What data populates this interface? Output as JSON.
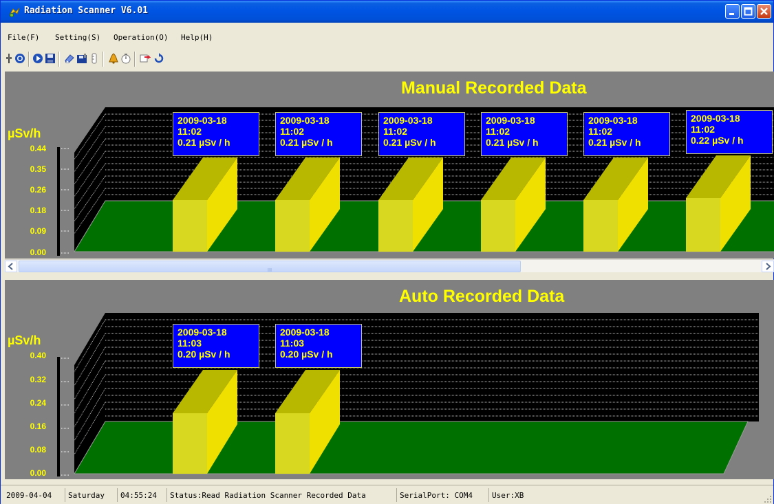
{
  "window": {
    "title": "Radiation Scanner V6.01"
  },
  "menu": [
    {
      "label": "File(F)"
    },
    {
      "label": "Setting(S)"
    },
    {
      "label": "Operation(O)"
    },
    {
      "label": "Help(H)"
    }
  ],
  "toolbar": [
    {
      "icon": "connect-icon"
    },
    {
      "icon": "stop-icon"
    },
    {
      "icon": "play-icon"
    },
    {
      "icon": "save-icon"
    },
    {
      "icon": "erase-icon"
    },
    {
      "icon": "save-disk-icon"
    },
    {
      "icon": "ruler-icon"
    },
    {
      "icon": "alarm-bell-icon"
    },
    {
      "icon": "timer-icon"
    },
    {
      "icon": "export-icon"
    },
    {
      "icon": "refresh-icon"
    }
  ],
  "charts": [
    {
      "title": "Manual Recorded Data",
      "unit": "µSv/h",
      "yticks": [
        "0.44",
        "0.35",
        "0.26",
        "0.18",
        "0.09",
        "0.00"
      ],
      "bars": [
        {
          "date": "2009-03-18",
          "time": "11:02",
          "value": "0.21 µSv / h"
        },
        {
          "date": "2009-03-18",
          "time": "11:02",
          "value": "0.21 µSv / h"
        },
        {
          "date": "2009-03-18",
          "time": "11:02",
          "value": "0.21 µSv / h"
        },
        {
          "date": "2009-03-18",
          "time": "11:02",
          "value": "0.21 µSv / h"
        },
        {
          "date": "2009-03-18",
          "time": "11:02",
          "value": "0.21 µSv / h"
        },
        {
          "date": "2009-03-18",
          "time": "11:02",
          "value": "0.22 µSv / h"
        }
      ]
    },
    {
      "title": "Auto Recorded Data",
      "unit": "µSv/h",
      "yticks": [
        "0.40",
        "0.32",
        "0.24",
        "0.16",
        "0.08",
        "0.00"
      ],
      "bars": [
        {
          "date": "2009-03-18",
          "time": "11:03",
          "value": "0.20 µSv / h"
        },
        {
          "date": "2009-03-18",
          "time": "11:03",
          "value": "0.20 µSv / h"
        }
      ]
    }
  ],
  "scrollbar": {
    "thumb_grip": "III"
  },
  "status": {
    "date": "2009-04-04",
    "day": "Saturday",
    "time": "04:55:24",
    "status": "Status:Read Radiation Scanner Recorded Data",
    "port": "SerialPort: COM4",
    "user": "User:XB"
  }
}
